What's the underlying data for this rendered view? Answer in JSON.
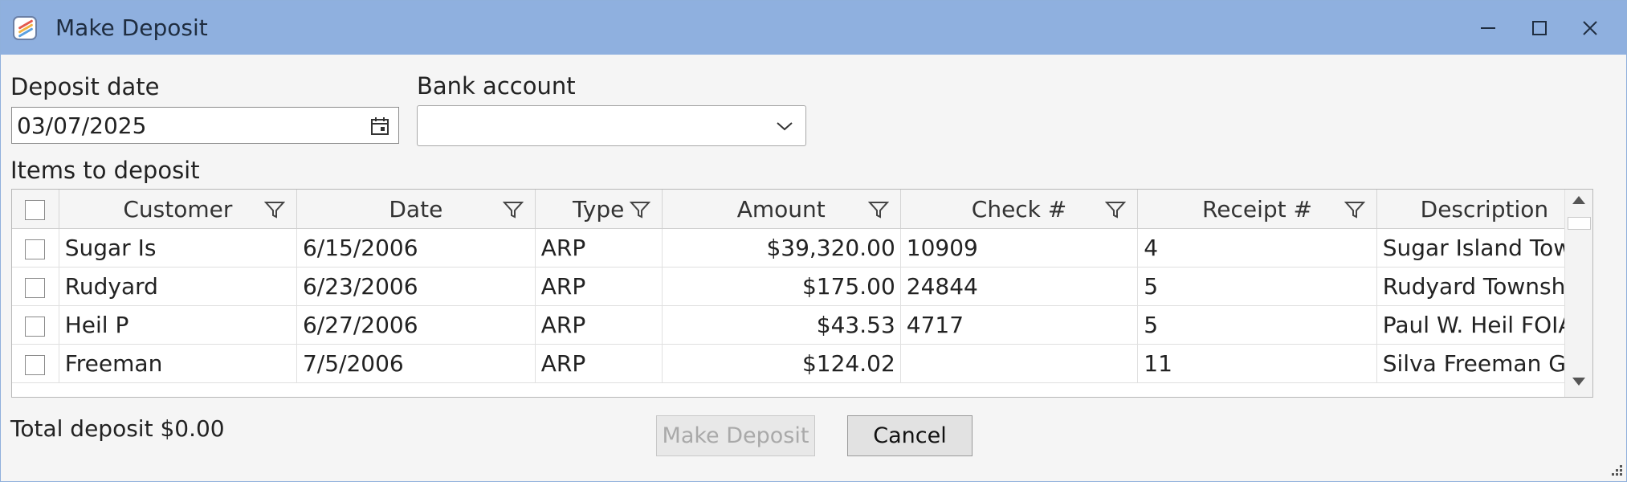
{
  "window": {
    "title": "Make Deposit"
  },
  "form": {
    "deposit_date_label": "Deposit date",
    "deposit_date_value": "03/07/2025",
    "bank_account_label": "Bank account",
    "bank_account_value": "",
    "items_label": "Items to deposit"
  },
  "grid": {
    "columns": [
      "Customer",
      "Date",
      "Type",
      "Amount",
      "Check #",
      "Receipt #",
      "Description"
    ],
    "rows": [
      {
        "customer": "Sugar Is",
        "date": "6/15/2006",
        "type": "ARP",
        "amount": "$39,320.00",
        "check": "10909",
        "receipt": "4",
        "description": "Sugar Island Town"
      },
      {
        "customer": "Rudyard",
        "date": "6/23/2006",
        "type": "ARP",
        "amount": "$175.00",
        "check": "24844",
        "receipt": "5",
        "description": "Rudyard Township"
      },
      {
        "customer": "Heil P",
        "date": "6/27/2006",
        "type": "ARP",
        "amount": "$43.53",
        "check": "4717",
        "receipt": "5",
        "description": "Paul W. Heil FOIA"
      },
      {
        "customer": "Freeman",
        "date": "7/5/2006",
        "type": "ARP",
        "amount": "$124.02",
        "check": "",
        "receipt": "11",
        "description": "Silva Freeman GR"
      }
    ]
  },
  "footer": {
    "total_label": "Total deposit $0.00",
    "make_deposit_label": "Make Deposit",
    "cancel_label": "Cancel"
  },
  "icons": {
    "app": "app-icon",
    "minimize": "minimize-icon",
    "maximize": "maximize-icon",
    "close": "close-icon",
    "calendar": "calendar-icon",
    "dropdown": "chevron-down-icon",
    "filter": "filter-icon"
  },
  "colors": {
    "titlebar": "#8fb0df",
    "window_bg": "#f5f5f5"
  }
}
